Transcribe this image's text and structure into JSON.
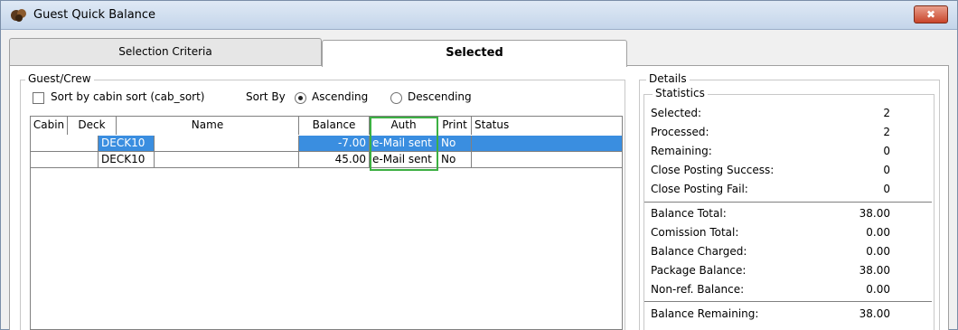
{
  "window": {
    "title": "Guest Quick Balance",
    "close_label": "✖"
  },
  "tabs": [
    {
      "label": "Selection Criteria"
    },
    {
      "label": "Selected"
    }
  ],
  "guest_group": {
    "legend": "Guest/Crew",
    "sort_checkbox_label": "Sort by cabin sort (cab_sort)",
    "sort_by_label": "Sort By",
    "ascending_label": "Ascending",
    "descending_label": "Descending"
  },
  "grid": {
    "columns": [
      "Cabin",
      "Deck",
      "Name",
      "Balance",
      "Auth",
      "Print",
      "Status"
    ],
    "rows": [
      {
        "cabin": "",
        "deck": "DECK10",
        "name": "",
        "balance": "-7.00",
        "auth": "e-Mail sent",
        "print": "No",
        "status": ""
      },
      {
        "cabin": "",
        "deck": "DECK10",
        "name": "",
        "balance": "45.00",
        "auth": "e-Mail sent",
        "print": "No",
        "status": ""
      }
    ]
  },
  "details": {
    "legend": "Details",
    "statistics_legend": "Statistics",
    "stats": [
      {
        "label": "Selected:",
        "value": "2"
      },
      {
        "label": "Processed:",
        "value": "2"
      },
      {
        "label": "Remaining:",
        "value": "0"
      },
      {
        "label": "Close Posting Success:",
        "value": "0"
      },
      {
        "label": "Close Posting Fail:",
        "value": "0"
      }
    ],
    "balances": [
      {
        "label": "Balance Total:",
        "value": "38.00"
      },
      {
        "label": "Comission Total:",
        "value": "0.00"
      },
      {
        "label": "Balance Charged:",
        "value": "0.00"
      },
      {
        "label": "Package Balance:",
        "value": "38.00"
      },
      {
        "label": "Non-ref. Balance:",
        "value": "0.00"
      }
    ],
    "remaining": {
      "label": "Balance Remaining:",
      "value": "38.00"
    }
  },
  "colors": {
    "selection": "#3a8ee0",
    "highlight": "#3cb043",
    "close": "#c9452b"
  }
}
